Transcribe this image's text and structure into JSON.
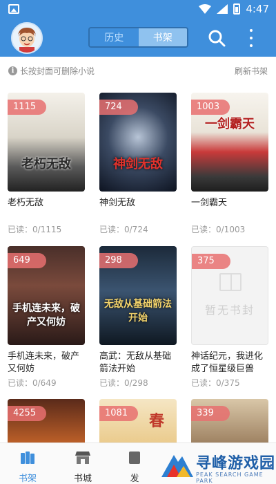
{
  "status_bar": {
    "time": "4:47"
  },
  "app_bar": {
    "tabs": [
      {
        "label": "历史",
        "active": false
      },
      {
        "label": "书架",
        "active": true
      }
    ],
    "search_icon": "search-icon",
    "more_icon": "more-vert-icon"
  },
  "hint": {
    "text": "长按封面可删除小说",
    "refresh_label": "刷新书架"
  },
  "books": [
    {
      "count": "1115",
      "title": "老朽无敌",
      "cover_text": "老朽无敌",
      "read": "已读：0/1115"
    },
    {
      "count": "724",
      "title": "神剑无敌",
      "cover_text": "神剑无敌",
      "read": "已读：0/724"
    },
    {
      "count": "1003",
      "title": "一剑霸天",
      "cover_text": "一剑霸天",
      "read": "已读：0/1003"
    },
    {
      "count": "649",
      "title": "手机连未来，破产又何妨",
      "cover_text": "手机连未来，破产又何妨",
      "read": "已读：0/649"
    },
    {
      "count": "298",
      "title": "高武：无敌从基础箭法开始",
      "cover_text": "无敌从基础箭法开始",
      "read": "已读：0/298"
    },
    {
      "count": "375",
      "title": "神话纪元，我进化成了恒星级巨兽",
      "cover_text": "暂无书封",
      "read": "已读：0/375"
    },
    {
      "count": "4255",
      "title": "",
      "cover_text": "",
      "read": ""
    },
    {
      "count": "1081",
      "title": "",
      "cover_text": "春",
      "read": ""
    },
    {
      "count": "339",
      "title": "",
      "cover_text": "",
      "read": ""
    }
  ],
  "tab_bar": {
    "items": [
      {
        "label": "书架",
        "icon": "bookshelf-icon",
        "active": true
      },
      {
        "label": "书城",
        "icon": "store-icon",
        "active": false
      },
      {
        "label": "发",
        "icon": "discover-icon",
        "active": false
      }
    ]
  },
  "watermark": {
    "text": "寻峰游戏园",
    "sub": "PEAK SEARCH GAME PARK"
  },
  "colors": {
    "primary": "#3f8fdc",
    "badge": "#e87070"
  }
}
